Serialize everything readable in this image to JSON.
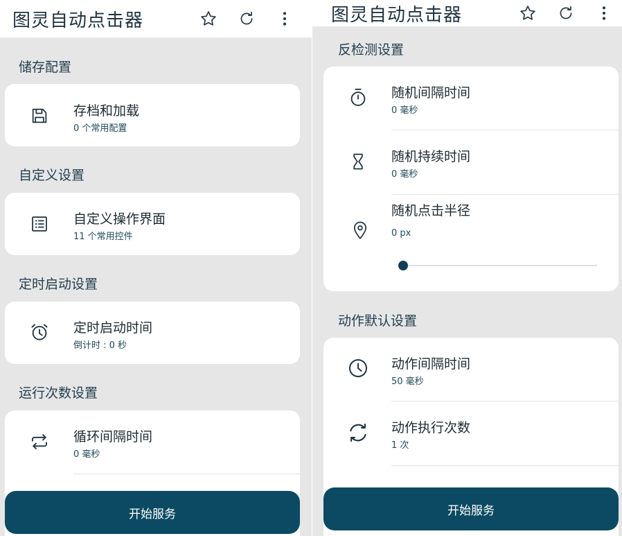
{
  "colors": {
    "accent": "#0b4a62",
    "background": "#e6e6e6",
    "card": "#ffffff",
    "subtitle": "#1f4a5a"
  },
  "left_screen": {
    "app_title": "图灵自动点击器",
    "sections": [
      {
        "title": "储存配置",
        "items": [
          {
            "icon": "save-icon",
            "title": "存档和加载",
            "subtitle": "0 个常用配置"
          }
        ]
      },
      {
        "title": "自定义设置",
        "items": [
          {
            "icon": "list-icon",
            "title": "自定义操作界面",
            "subtitle": "11 个常用控件"
          }
        ]
      },
      {
        "title": "定时启动设置",
        "items": [
          {
            "icon": "alarm-clock-icon",
            "title": "定时启动时间",
            "subtitle": "倒计时 : 0 秒"
          }
        ]
      },
      {
        "title": "运行次数设置",
        "items": [
          {
            "icon": "repeat-icon",
            "title": "循环间隔时间",
            "subtitle": "0 毫秒"
          }
        ]
      }
    ],
    "start_button": "开始服务"
  },
  "right_screen": {
    "app_title": "图灵自动点击器",
    "sections": [
      {
        "title": "反检测设置",
        "items": [
          {
            "icon": "stopwatch-icon",
            "title": "随机间隔时间",
            "subtitle": "0 毫秒"
          },
          {
            "icon": "hourglass-icon",
            "title": "随机持续时间",
            "subtitle": "0 毫秒"
          },
          {
            "icon": "location-pin-icon",
            "title": "随机点击半径",
            "subtitle": "0 px",
            "slider_value": 0
          }
        ]
      },
      {
        "title": "动作默认设置",
        "items": [
          {
            "icon": "clock-icon",
            "title": "动作间隔时间",
            "subtitle": "50 毫秒"
          },
          {
            "icon": "sync-icon",
            "title": "动作执行次数",
            "subtitle": "1 次"
          }
        ]
      }
    ],
    "start_button": "开始服务"
  }
}
